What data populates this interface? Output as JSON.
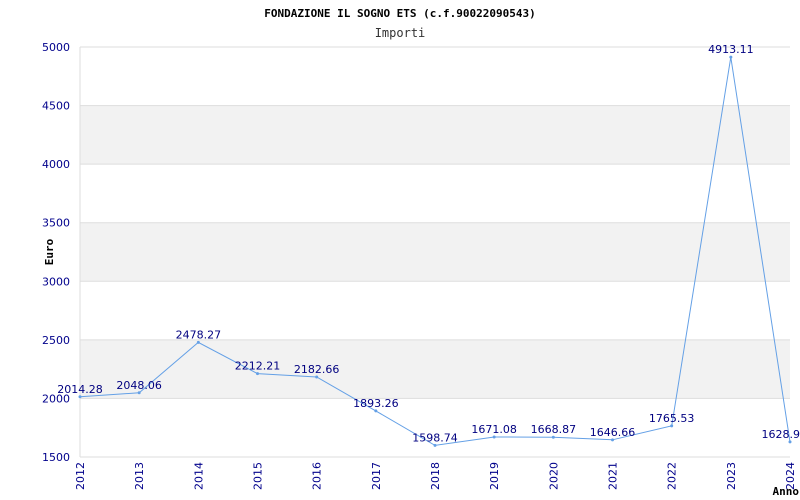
{
  "chart_data": {
    "type": "line",
    "title": "FONDAZIONE IL SOGNO ETS (c.f.90022090543)",
    "subtitle": "Importi",
    "xlabel": "Anno",
    "ylabel": "Euro",
    "ylim": [
      1500,
      5000
    ],
    "yticks": [
      1500,
      2000,
      2500,
      3000,
      3500,
      4000,
      4500,
      5000
    ],
    "grid": true,
    "categories": [
      "2012",
      "2013",
      "2014",
      "2015",
      "2016",
      "2017",
      "2018",
      "2019",
      "2020",
      "2021",
      "2022",
      "2023",
      "2024"
    ],
    "series": [
      {
        "values": [
          2014.28,
          2048.06,
          2478.27,
          2212.21,
          2182.66,
          1893.26,
          1598.74,
          1671.08,
          1668.87,
          1646.66,
          1765.53,
          4913.11,
          1628.9
        ],
        "labels": [
          "2014.28",
          "2048.06",
          "2478.27",
          "2212.21",
          "2182.66",
          "1893.26",
          "1598.74",
          "1671.08",
          "1668.87",
          "1646.66",
          "1765.53",
          "4913.11",
          "1628.9"
        ]
      }
    ],
    "colors": {
      "line": "#64a0e6",
      "band": "#f2f2f2",
      "grid": "#dddddd",
      "tick": "#00008b",
      "label": "#000080"
    }
  }
}
